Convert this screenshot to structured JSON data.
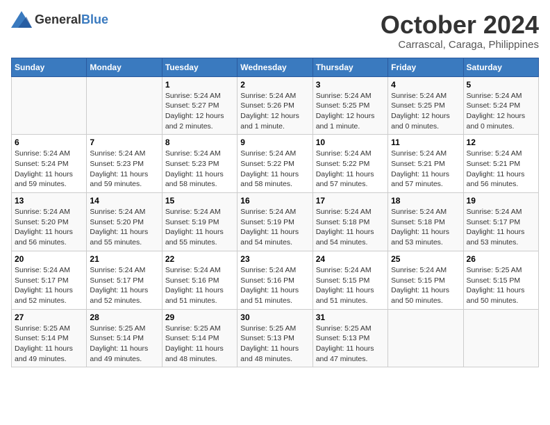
{
  "header": {
    "logo_general": "General",
    "logo_blue": "Blue",
    "month": "October 2024",
    "location": "Carrascal, Caraga, Philippines"
  },
  "weekdays": [
    "Sunday",
    "Monday",
    "Tuesday",
    "Wednesday",
    "Thursday",
    "Friday",
    "Saturday"
  ],
  "weeks": [
    [
      {
        "day": "",
        "detail": ""
      },
      {
        "day": "",
        "detail": ""
      },
      {
        "day": "1",
        "detail": "Sunrise: 5:24 AM\nSunset: 5:27 PM\nDaylight: 12 hours\nand 2 minutes."
      },
      {
        "day": "2",
        "detail": "Sunrise: 5:24 AM\nSunset: 5:26 PM\nDaylight: 12 hours\nand 1 minute."
      },
      {
        "day": "3",
        "detail": "Sunrise: 5:24 AM\nSunset: 5:25 PM\nDaylight: 12 hours\nand 1 minute."
      },
      {
        "day": "4",
        "detail": "Sunrise: 5:24 AM\nSunset: 5:25 PM\nDaylight: 12 hours\nand 0 minutes."
      },
      {
        "day": "5",
        "detail": "Sunrise: 5:24 AM\nSunset: 5:24 PM\nDaylight: 12 hours\nand 0 minutes."
      }
    ],
    [
      {
        "day": "6",
        "detail": "Sunrise: 5:24 AM\nSunset: 5:24 PM\nDaylight: 11 hours\nand 59 minutes."
      },
      {
        "day": "7",
        "detail": "Sunrise: 5:24 AM\nSunset: 5:23 PM\nDaylight: 11 hours\nand 59 minutes."
      },
      {
        "day": "8",
        "detail": "Sunrise: 5:24 AM\nSunset: 5:23 PM\nDaylight: 11 hours\nand 58 minutes."
      },
      {
        "day": "9",
        "detail": "Sunrise: 5:24 AM\nSunset: 5:22 PM\nDaylight: 11 hours\nand 58 minutes."
      },
      {
        "day": "10",
        "detail": "Sunrise: 5:24 AM\nSunset: 5:22 PM\nDaylight: 11 hours\nand 57 minutes."
      },
      {
        "day": "11",
        "detail": "Sunrise: 5:24 AM\nSunset: 5:21 PM\nDaylight: 11 hours\nand 57 minutes."
      },
      {
        "day": "12",
        "detail": "Sunrise: 5:24 AM\nSunset: 5:21 PM\nDaylight: 11 hours\nand 56 minutes."
      }
    ],
    [
      {
        "day": "13",
        "detail": "Sunrise: 5:24 AM\nSunset: 5:20 PM\nDaylight: 11 hours\nand 56 minutes."
      },
      {
        "day": "14",
        "detail": "Sunrise: 5:24 AM\nSunset: 5:20 PM\nDaylight: 11 hours\nand 55 minutes."
      },
      {
        "day": "15",
        "detail": "Sunrise: 5:24 AM\nSunset: 5:19 PM\nDaylight: 11 hours\nand 55 minutes."
      },
      {
        "day": "16",
        "detail": "Sunrise: 5:24 AM\nSunset: 5:19 PM\nDaylight: 11 hours\nand 54 minutes."
      },
      {
        "day": "17",
        "detail": "Sunrise: 5:24 AM\nSunset: 5:18 PM\nDaylight: 11 hours\nand 54 minutes."
      },
      {
        "day": "18",
        "detail": "Sunrise: 5:24 AM\nSunset: 5:18 PM\nDaylight: 11 hours\nand 53 minutes."
      },
      {
        "day": "19",
        "detail": "Sunrise: 5:24 AM\nSunset: 5:17 PM\nDaylight: 11 hours\nand 53 minutes."
      }
    ],
    [
      {
        "day": "20",
        "detail": "Sunrise: 5:24 AM\nSunset: 5:17 PM\nDaylight: 11 hours\nand 52 minutes."
      },
      {
        "day": "21",
        "detail": "Sunrise: 5:24 AM\nSunset: 5:17 PM\nDaylight: 11 hours\nand 52 minutes."
      },
      {
        "day": "22",
        "detail": "Sunrise: 5:24 AM\nSunset: 5:16 PM\nDaylight: 11 hours\nand 51 minutes."
      },
      {
        "day": "23",
        "detail": "Sunrise: 5:24 AM\nSunset: 5:16 PM\nDaylight: 11 hours\nand 51 minutes."
      },
      {
        "day": "24",
        "detail": "Sunrise: 5:24 AM\nSunset: 5:15 PM\nDaylight: 11 hours\nand 51 minutes."
      },
      {
        "day": "25",
        "detail": "Sunrise: 5:24 AM\nSunset: 5:15 PM\nDaylight: 11 hours\nand 50 minutes."
      },
      {
        "day": "26",
        "detail": "Sunrise: 5:25 AM\nSunset: 5:15 PM\nDaylight: 11 hours\nand 50 minutes."
      }
    ],
    [
      {
        "day": "27",
        "detail": "Sunrise: 5:25 AM\nSunset: 5:14 PM\nDaylight: 11 hours\nand 49 minutes."
      },
      {
        "day": "28",
        "detail": "Sunrise: 5:25 AM\nSunset: 5:14 PM\nDaylight: 11 hours\nand 49 minutes."
      },
      {
        "day": "29",
        "detail": "Sunrise: 5:25 AM\nSunset: 5:14 PM\nDaylight: 11 hours\nand 48 minutes."
      },
      {
        "day": "30",
        "detail": "Sunrise: 5:25 AM\nSunset: 5:13 PM\nDaylight: 11 hours\nand 48 minutes."
      },
      {
        "day": "31",
        "detail": "Sunrise: 5:25 AM\nSunset: 5:13 PM\nDaylight: 11 hours\nand 47 minutes."
      },
      {
        "day": "",
        "detail": ""
      },
      {
        "day": "",
        "detail": ""
      }
    ]
  ]
}
